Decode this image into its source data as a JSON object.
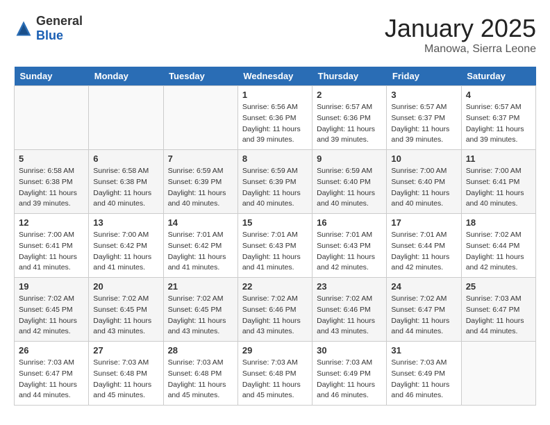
{
  "header": {
    "logo_general": "General",
    "logo_blue": "Blue",
    "month": "January 2025",
    "location": "Manowa, Sierra Leone"
  },
  "days_of_week": [
    "Sunday",
    "Monday",
    "Tuesday",
    "Wednesday",
    "Thursday",
    "Friday",
    "Saturday"
  ],
  "weeks": [
    [
      {
        "day": "",
        "info": ""
      },
      {
        "day": "",
        "info": ""
      },
      {
        "day": "",
        "info": ""
      },
      {
        "day": "1",
        "info": "Sunrise: 6:56 AM\nSunset: 6:36 PM\nDaylight: 11 hours\nand 39 minutes."
      },
      {
        "day": "2",
        "info": "Sunrise: 6:57 AM\nSunset: 6:36 PM\nDaylight: 11 hours\nand 39 minutes."
      },
      {
        "day": "3",
        "info": "Sunrise: 6:57 AM\nSunset: 6:37 PM\nDaylight: 11 hours\nand 39 minutes."
      },
      {
        "day": "4",
        "info": "Sunrise: 6:57 AM\nSunset: 6:37 PM\nDaylight: 11 hours\nand 39 minutes."
      }
    ],
    [
      {
        "day": "5",
        "info": "Sunrise: 6:58 AM\nSunset: 6:38 PM\nDaylight: 11 hours\nand 39 minutes."
      },
      {
        "day": "6",
        "info": "Sunrise: 6:58 AM\nSunset: 6:38 PM\nDaylight: 11 hours\nand 40 minutes."
      },
      {
        "day": "7",
        "info": "Sunrise: 6:59 AM\nSunset: 6:39 PM\nDaylight: 11 hours\nand 40 minutes."
      },
      {
        "day": "8",
        "info": "Sunrise: 6:59 AM\nSunset: 6:39 PM\nDaylight: 11 hours\nand 40 minutes."
      },
      {
        "day": "9",
        "info": "Sunrise: 6:59 AM\nSunset: 6:40 PM\nDaylight: 11 hours\nand 40 minutes."
      },
      {
        "day": "10",
        "info": "Sunrise: 7:00 AM\nSunset: 6:40 PM\nDaylight: 11 hours\nand 40 minutes."
      },
      {
        "day": "11",
        "info": "Sunrise: 7:00 AM\nSunset: 6:41 PM\nDaylight: 11 hours\nand 40 minutes."
      }
    ],
    [
      {
        "day": "12",
        "info": "Sunrise: 7:00 AM\nSunset: 6:41 PM\nDaylight: 11 hours\nand 41 minutes."
      },
      {
        "day": "13",
        "info": "Sunrise: 7:00 AM\nSunset: 6:42 PM\nDaylight: 11 hours\nand 41 minutes."
      },
      {
        "day": "14",
        "info": "Sunrise: 7:01 AM\nSunset: 6:42 PM\nDaylight: 11 hours\nand 41 minutes."
      },
      {
        "day": "15",
        "info": "Sunrise: 7:01 AM\nSunset: 6:43 PM\nDaylight: 11 hours\nand 41 minutes."
      },
      {
        "day": "16",
        "info": "Sunrise: 7:01 AM\nSunset: 6:43 PM\nDaylight: 11 hours\nand 42 minutes."
      },
      {
        "day": "17",
        "info": "Sunrise: 7:01 AM\nSunset: 6:44 PM\nDaylight: 11 hours\nand 42 minutes."
      },
      {
        "day": "18",
        "info": "Sunrise: 7:02 AM\nSunset: 6:44 PM\nDaylight: 11 hours\nand 42 minutes."
      }
    ],
    [
      {
        "day": "19",
        "info": "Sunrise: 7:02 AM\nSunset: 6:45 PM\nDaylight: 11 hours\nand 42 minutes."
      },
      {
        "day": "20",
        "info": "Sunrise: 7:02 AM\nSunset: 6:45 PM\nDaylight: 11 hours\nand 43 minutes."
      },
      {
        "day": "21",
        "info": "Sunrise: 7:02 AM\nSunset: 6:45 PM\nDaylight: 11 hours\nand 43 minutes."
      },
      {
        "day": "22",
        "info": "Sunrise: 7:02 AM\nSunset: 6:46 PM\nDaylight: 11 hours\nand 43 minutes."
      },
      {
        "day": "23",
        "info": "Sunrise: 7:02 AM\nSunset: 6:46 PM\nDaylight: 11 hours\nand 43 minutes."
      },
      {
        "day": "24",
        "info": "Sunrise: 7:02 AM\nSunset: 6:47 PM\nDaylight: 11 hours\nand 44 minutes."
      },
      {
        "day": "25",
        "info": "Sunrise: 7:03 AM\nSunset: 6:47 PM\nDaylight: 11 hours\nand 44 minutes."
      }
    ],
    [
      {
        "day": "26",
        "info": "Sunrise: 7:03 AM\nSunset: 6:47 PM\nDaylight: 11 hours\nand 44 minutes."
      },
      {
        "day": "27",
        "info": "Sunrise: 7:03 AM\nSunset: 6:48 PM\nDaylight: 11 hours\nand 45 minutes."
      },
      {
        "day": "28",
        "info": "Sunrise: 7:03 AM\nSunset: 6:48 PM\nDaylight: 11 hours\nand 45 minutes."
      },
      {
        "day": "29",
        "info": "Sunrise: 7:03 AM\nSunset: 6:48 PM\nDaylight: 11 hours\nand 45 minutes."
      },
      {
        "day": "30",
        "info": "Sunrise: 7:03 AM\nSunset: 6:49 PM\nDaylight: 11 hours\nand 46 minutes."
      },
      {
        "day": "31",
        "info": "Sunrise: 7:03 AM\nSunset: 6:49 PM\nDaylight: 11 hours\nand 46 minutes."
      },
      {
        "day": "",
        "info": ""
      }
    ]
  ]
}
